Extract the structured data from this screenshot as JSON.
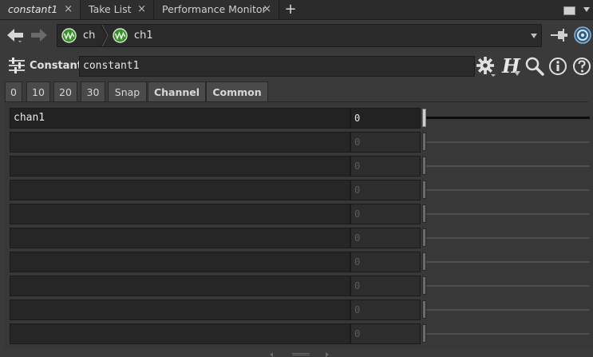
{
  "tabs": [
    {
      "label": "constant1",
      "close": "×",
      "active": true
    },
    {
      "label": "Take List",
      "close": "×",
      "active": false
    },
    {
      "label": "Performance Monitor",
      "close": "×",
      "active": false
    }
  ],
  "add_tab": "+",
  "path": {
    "crumbs": [
      {
        "label": "ch"
      },
      {
        "label": "ch1"
      }
    ]
  },
  "header": {
    "op_type": "Constant",
    "op_name": "constant1",
    "help_letter": "H"
  },
  "param_tabs": [
    {
      "label": "0",
      "bold": false
    },
    {
      "label": "10",
      "bold": false
    },
    {
      "label": "20",
      "bold": false
    },
    {
      "label": "30",
      "bold": false
    },
    {
      "label": "Snap",
      "bold": false
    },
    {
      "label": "Channel",
      "bold": true
    },
    {
      "label": "Common",
      "bold": true
    }
  ],
  "channels": [
    {
      "name": "chan1",
      "value": "0",
      "enabled": true
    },
    {
      "name": "",
      "value": "0",
      "enabled": false
    },
    {
      "name": "",
      "value": "0",
      "enabled": false
    },
    {
      "name": "",
      "value": "0",
      "enabled": false
    },
    {
      "name": "",
      "value": "0",
      "enabled": false
    },
    {
      "name": "",
      "value": "0",
      "enabled": false
    },
    {
      "name": "",
      "value": "0",
      "enabled": false
    },
    {
      "name": "",
      "value": "0",
      "enabled": false
    },
    {
      "name": "",
      "value": "0",
      "enabled": false
    },
    {
      "name": "",
      "value": "0",
      "enabled": false
    }
  ],
  "icons": {
    "back": "arrow-left-icon",
    "forward": "arrow-right-icon",
    "crumb": "chop-network-icon",
    "pin": "pin-icon",
    "link": "link-icon",
    "op": "parameters-icon",
    "gear": "gear-icon",
    "help": "houdini-help-icon",
    "search": "search-icon",
    "info": "info-icon",
    "help2": "help-icon"
  },
  "colors": {
    "chop_icon": "#3b8f2e",
    "background": "#3a3a3a"
  }
}
